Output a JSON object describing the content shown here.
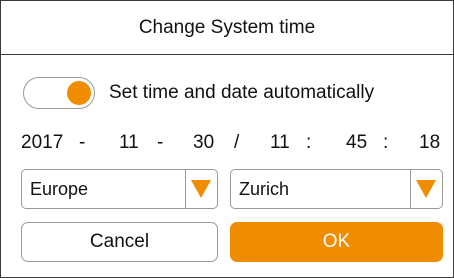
{
  "dialog": {
    "title": "Change System time",
    "auto_label": "Set time and date automatically",
    "auto_enabled": true
  },
  "datetime": {
    "year": "2017",
    "sep1": "-",
    "month": "11",
    "sep2": "-",
    "day": "30",
    "sep3": "/",
    "hour": "11",
    "sep4": ":",
    "minute": "45",
    "sep5": ":",
    "second": "18"
  },
  "region": {
    "value": "Europe",
    "icon": "dropdown-arrow-icon"
  },
  "city": {
    "value": "Zurich",
    "icon": "dropdown-arrow-icon"
  },
  "buttons": {
    "cancel": "Cancel",
    "ok": "OK"
  },
  "colors": {
    "accent": "#f08c00",
    "border": "#9a9a9a",
    "text": "#111111"
  }
}
